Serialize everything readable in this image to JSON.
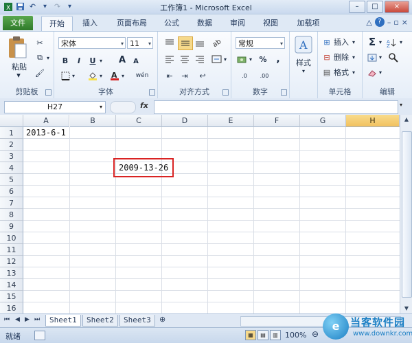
{
  "window": {
    "title": "工作簿1 - Microsoft Excel",
    "minimize": "–",
    "restore": "□",
    "close": "×"
  },
  "qat": {
    "save_icon": "floppy-icon",
    "undo_glyph": "↶",
    "redo_glyph": "↷",
    "more_glyph": "▾"
  },
  "tabs": [
    {
      "label": "文件"
    },
    {
      "label": "开始"
    },
    {
      "label": "插入"
    },
    {
      "label": "页面布局"
    },
    {
      "label": "公式"
    },
    {
      "label": "数据"
    },
    {
      "label": "审阅"
    },
    {
      "label": "视图"
    },
    {
      "label": "加载项"
    }
  ],
  "ribbon": {
    "clipboard": {
      "label": "剪贴板",
      "paste": "粘贴"
    },
    "font": {
      "label": "字体",
      "family": "宋体",
      "size": "11",
      "bold": "B",
      "italic": "I",
      "underline": "U",
      "grow": "A",
      "shrink": "A",
      "fill_color": "#f7e14b",
      "font_color": "#d42020",
      "wen": "wén"
    },
    "alignment": {
      "label": "对齐方式"
    },
    "number": {
      "label": "数字",
      "format": "常规",
      "percent": "%",
      "comma": ",",
      "dec_inc": ".0",
      "dec_dec": ".00"
    },
    "styles": {
      "label": "样式"
    },
    "cells": {
      "label": "单元格",
      "insert": "插入",
      "delete": "删除",
      "format": "格式"
    },
    "editing": {
      "label": "编辑",
      "sum": "Σ"
    }
  },
  "formula_bar": {
    "name_box": "H27",
    "fx": "fx",
    "value": ""
  },
  "columns": [
    "A",
    "B",
    "C",
    "D",
    "E",
    "F",
    "G",
    "H"
  ],
  "selected_column": "H",
  "rows": [
    "1",
    "2",
    "3",
    "4",
    "5",
    "6",
    "7",
    "8",
    "9",
    "10",
    "11",
    "12",
    "13",
    "14",
    "15",
    "16"
  ],
  "cells": {
    "A1": "2013-6-1",
    "C4": "2009-13-26"
  },
  "sheets": [
    "Sheet1",
    "Sheet2",
    "Sheet3"
  ],
  "active_sheet": "Sheet1",
  "status": {
    "ready": "就绪",
    "zoom": "100%",
    "zoom_minus": "⊖"
  },
  "watermark": {
    "title": "当客软件园",
    "url": "www.downkr.com",
    "mark": "e"
  },
  "colors": {
    "highlight_border": "#d92323",
    "selected_header": "#f1c15f",
    "file_tab": "#2f7a2a"
  }
}
